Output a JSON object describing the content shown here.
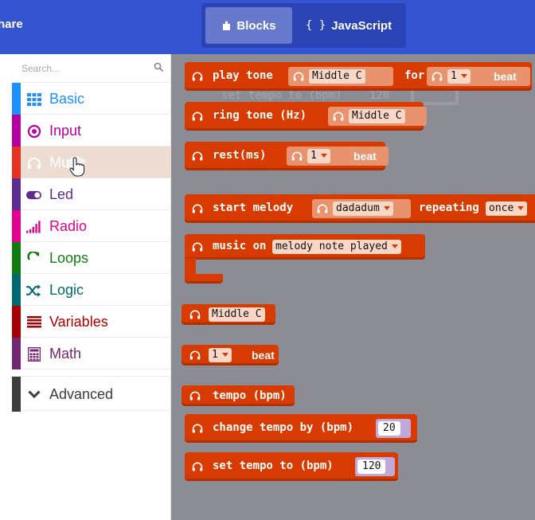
{
  "header": {
    "share_label": "hare",
    "blocks_label": "Blocks",
    "js_label": "JavaScript",
    "js_brace": "{ }"
  },
  "colors": {
    "header_bg": "#3454d1",
    "music_block": "#d83b01",
    "workspace_bg": "#8c8c95",
    "basic": "#1e90ff",
    "input": "#b4009e",
    "music": "#e63022",
    "led": "#5c2d91",
    "radio": "#e3008c",
    "loops": "#107c10",
    "logic": "#006970",
    "variables": "#a80000",
    "math": "#712672",
    "advanced": "#3c3c3c"
  },
  "toolbox": {
    "search_placeholder": "Search...",
    "categories": [
      {
        "label": "Basic",
        "icon": "grid-icon"
      },
      {
        "label": "Input",
        "icon": "target-icon"
      },
      {
        "label": "Music",
        "icon": "headphones-icon"
      },
      {
        "label": "Led",
        "icon": "toggle-icon"
      },
      {
        "label": "Radio",
        "icon": "signal-bars-icon"
      },
      {
        "label": "Loops",
        "icon": "refresh-icon"
      },
      {
        "label": "Logic",
        "icon": "shuffle-icon"
      },
      {
        "label": "Variables",
        "icon": "list-icon"
      },
      {
        "label": "Math",
        "icon": "calculator-icon"
      }
    ],
    "advanced": {
      "label": "Advanced",
      "icon": "chevron-down-icon"
    }
  },
  "ghost_text": {
    "set_tempo": "set tempo to (bpm)",
    "tempo_value": "120"
  },
  "blocks": {
    "play_tone": {
      "label": "play tone",
      "note": "Middle C",
      "for_label": "for",
      "beat_value": "1",
      "beat_label": "beat"
    },
    "ring_tone": {
      "label": "ring tone (Hz)",
      "note": "Middle C"
    },
    "rest": {
      "label": "rest(ms)",
      "beat_value": "1",
      "beat_label": "beat"
    },
    "start_melody": {
      "label": "start melody",
      "melody": "dadadum",
      "repeating_label": "repeating",
      "repeat_value": "once"
    },
    "music_on": {
      "label": "music on",
      "event": "melody note played"
    },
    "note_reporter": {
      "note": "Middle C"
    },
    "beat_reporter": {
      "beat_value": "1",
      "beat_label": "beat"
    },
    "tempo": {
      "label": "tempo (bpm)"
    },
    "change_tempo": {
      "label": "change tempo by (bpm)",
      "value": "20"
    },
    "set_tempo": {
      "label": "set tempo to (bpm)",
      "value": "120"
    }
  }
}
